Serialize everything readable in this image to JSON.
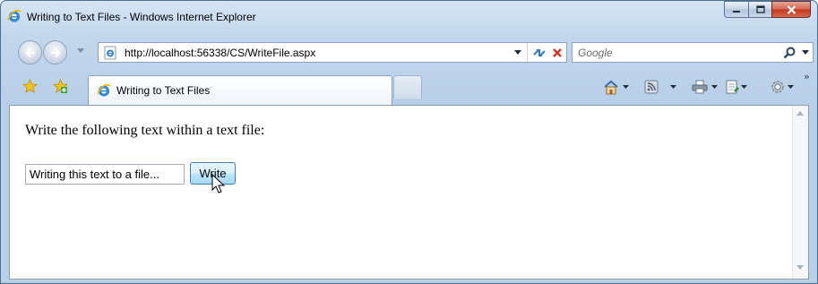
{
  "window": {
    "title": "Writing to Text Files - Windows Internet Explorer",
    "icon": "ie-logo-icon"
  },
  "caption_buttons": {
    "minimize": "minimize-icon",
    "maximize": "maximize-icon",
    "close": "close-icon"
  },
  "navigation": {
    "back_icon": "back-arrow-icon",
    "forward_icon": "forward-arrow-icon",
    "address_url": "http://localhost:56338/CS/WriteFile.aspx",
    "search_placeholder": "Google"
  },
  "tabs": [
    {
      "label": "Writing to Text Files",
      "active": true
    }
  ],
  "command_bar": {
    "items": [
      "home-icon",
      "feeds-icon",
      "print-icon",
      "page-icon",
      "tools-icon"
    ]
  },
  "page": {
    "instruction": "Write the following text within a text file:",
    "input_value": "Writing this text to a file...",
    "button_label": "Write"
  },
  "colors": {
    "frame": "#c2d7ec",
    "close_button": "#c3391f",
    "button_hover": "#bee6fd"
  }
}
